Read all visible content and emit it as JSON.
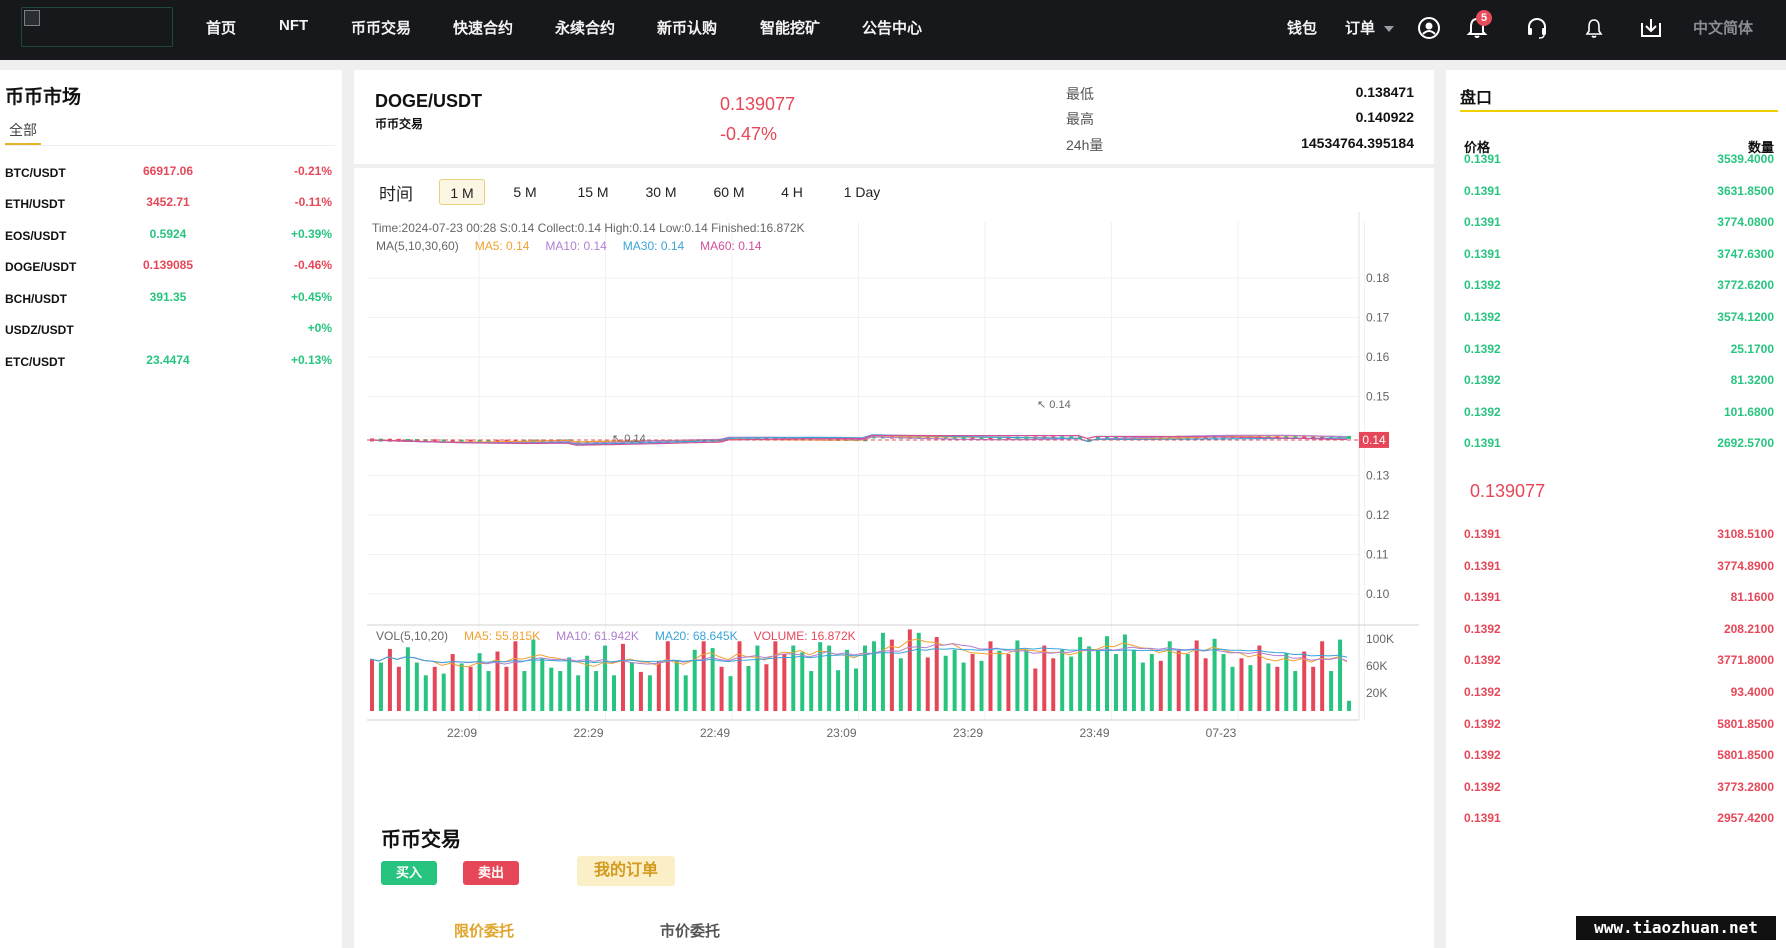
{
  "nav": {
    "items": [
      "首页",
      "NFT",
      "币币交易",
      "快速合约",
      "永续合约",
      "新币认购",
      "智能挖矿",
      "公告中心"
    ],
    "wallet": "钱包",
    "orders": "订单",
    "badge_count": "5",
    "language": "中文简体",
    "icons": [
      "user-circle-icon",
      "bell-icon",
      "headset-icon",
      "bell-outline-icon",
      "download-icon"
    ]
  },
  "market": {
    "title": "币币市场",
    "tab_all": "全部",
    "rows": [
      {
        "pair": "BTC/USDT",
        "price": "66917.06",
        "change": "-0.21%",
        "dir": "down"
      },
      {
        "pair": "ETH/USDT",
        "price": "3452.71",
        "change": "-0.11%",
        "dir": "down"
      },
      {
        "pair": "EOS/USDT",
        "price": "0.5924",
        "change": "+0.39%",
        "dir": "up"
      },
      {
        "pair": "DOGE/USDT",
        "price": "0.139085",
        "change": "-0.46%",
        "dir": "down"
      },
      {
        "pair": "BCH/USDT",
        "price": "391.35",
        "change": "+0.45%",
        "dir": "up"
      },
      {
        "pair": "USDZ/USDT",
        "price": "",
        "change": "+0%",
        "dir": "up"
      },
      {
        "pair": "ETC/USDT",
        "price": "23.4474",
        "change": "+0.13%",
        "dir": "up"
      }
    ]
  },
  "ticker": {
    "pair": "DOGE/USDT",
    "subtitle": "币币交易",
    "price": "0.139077",
    "change": "-0.47%",
    "low_label": "最低",
    "low": "0.138471",
    "high_label": "最高",
    "high": "0.140922",
    "vol_label": "24h量",
    "vol": "14534764.395184"
  },
  "timeframes": {
    "label": "时间",
    "options": [
      "1 M",
      "5 M",
      "15 M",
      "30 M",
      "60 M",
      "4 H",
      "1 Day"
    ],
    "active": "1 M"
  },
  "chart_data": {
    "type": "candlestick",
    "info_line": "Time:2024-07-23 00:28    S:0.14    Collect:0.14    High:0.14    Low:0.14    Finished:16.872K",
    "ma_line": {
      "label": "MA(5,10,30,60)",
      "items": [
        {
          "text": "MA5: 0.14",
          "color": "#f0a030"
        },
        {
          "text": "MA10: 0.14",
          "color": "#b07fd0"
        },
        {
          "text": "MA30: 0.14",
          "color": "#3aa3d8"
        },
        {
          "text": "MA60: 0.14",
          "color": "#d0509a"
        }
      ]
    },
    "price_axis": [
      "0.18",
      "0.17",
      "0.16",
      "0.15",
      "0.14",
      "0.13",
      "0.12",
      "0.11",
      "0.10"
    ],
    "last_price_tag": "0.14",
    "max_marker": "0.14",
    "min_marker": "0.14",
    "price_level": 0.139,
    "vol_line": {
      "label": "VOL(5,10,20)",
      "items": [
        {
          "text": "MA5: 55.815K",
          "color": "#f0a030"
        },
        {
          "text": "MA10: 61.942K",
          "color": "#b07fd0"
        },
        {
          "text": "MA20: 68.645K",
          "color": "#3aa3d8"
        },
        {
          "text": "VOLUME: 16.872K",
          "color": "#e64758"
        }
      ]
    },
    "vol_axis": [
      "100K",
      "60K",
      "20K"
    ],
    "time_axis": [
      "22:09",
      "22:29",
      "22:49",
      "23:09",
      "23:29",
      "23:49",
      "07-23"
    ],
    "colors": {
      "up": "#27c47f",
      "down": "#e64758"
    }
  },
  "trade": {
    "title": "币币交易",
    "buy": "买入",
    "sell": "卖出",
    "my_orders": "我的订单",
    "limit": "限价委托",
    "market": "市价委托"
  },
  "orderbook": {
    "title": "盘口",
    "head_price": "价格",
    "head_qty": "数量",
    "asks": [
      {
        "price": "0.1391",
        "qty": "3539.4000"
      },
      {
        "price": "0.1391",
        "qty": "3631.8500"
      },
      {
        "price": "0.1391",
        "qty": "3774.0800"
      },
      {
        "price": "0.1391",
        "qty": "3747.6300"
      },
      {
        "price": "0.1392",
        "qty": "3772.6200"
      },
      {
        "price": "0.1392",
        "qty": "3574.1200"
      },
      {
        "price": "0.1392",
        "qty": "25.1700"
      },
      {
        "price": "0.1392",
        "qty": "81.3200"
      },
      {
        "price": "0.1392",
        "qty": "101.6800"
      },
      {
        "price": "0.1391",
        "qty": "2692.5700"
      }
    ],
    "mid": "0.139077",
    "bids": [
      {
        "price": "0.1391",
        "qty": "3108.5100"
      },
      {
        "price": "0.1391",
        "qty": "3774.8900"
      },
      {
        "price": "0.1391",
        "qty": "81.1600"
      },
      {
        "price": "0.1392",
        "qty": "208.2100"
      },
      {
        "price": "0.1392",
        "qty": "3771.8000"
      },
      {
        "price": "0.1392",
        "qty": "93.4000"
      },
      {
        "price": "0.1392",
        "qty": "5801.8500"
      },
      {
        "price": "0.1392",
        "qty": "5801.8500"
      },
      {
        "price": "0.1392",
        "qty": "3773.2800"
      },
      {
        "price": "0.1391",
        "qty": "2957.4200"
      }
    ]
  },
  "watermark": "www.tiaozhuan.net"
}
